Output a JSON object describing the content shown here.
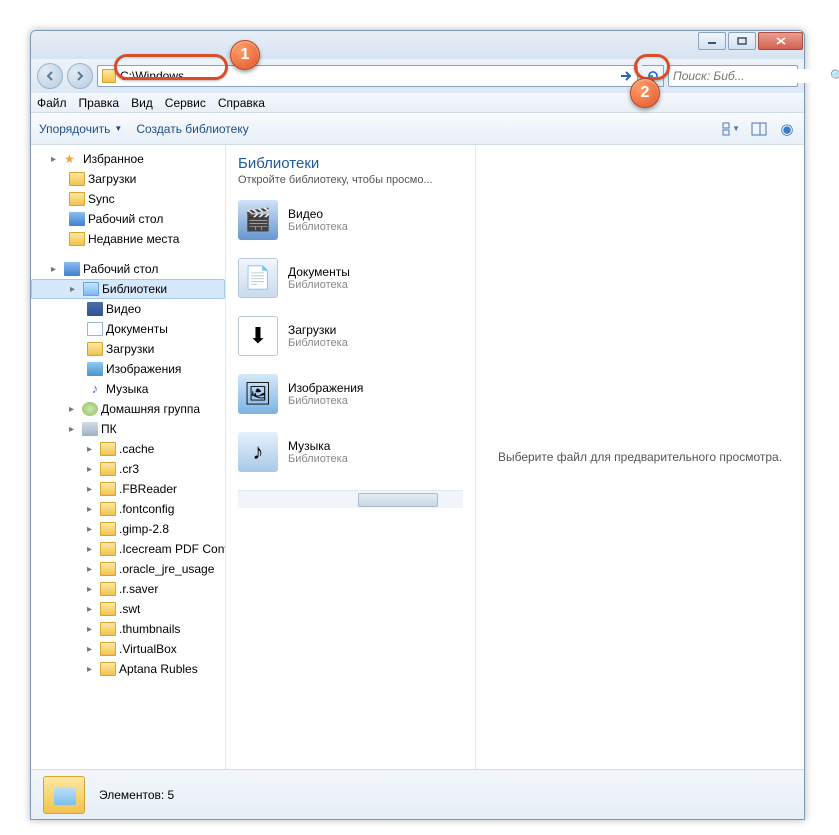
{
  "address_bar": {
    "value": "C:\\Windows"
  },
  "search": {
    "placeholder": "Поиск: Биб..."
  },
  "menu": {
    "file": "Файл",
    "edit": "Правка",
    "view": "Вид",
    "service": "Сервис",
    "help": "Справка"
  },
  "toolbar": {
    "organize": "Упорядочить",
    "create_lib": "Создать библиотеку"
  },
  "sidebar": {
    "fav": "Избранное",
    "downloads": "Загрузки",
    "sync": "Sync",
    "desktop": "Рабочий стол",
    "recent": "Недавние места",
    "desktop2": "Рабочий стол",
    "libraries": "Библиотеки",
    "video": "Видео",
    "documents": "Документы",
    "dl": "Загрузки",
    "images": "Изображения",
    "music": "Музыка",
    "homegroup": "Домашняя группа",
    "pc": "ПК",
    "folders": [
      ".cache",
      ".cr3",
      ".FBReader",
      ".fontconfig",
      ".gimp-2.8",
      ".Icecream PDF Conv",
      ".oracle_jre_usage",
      ".r.saver",
      ".swt",
      ".thumbnails",
      ".VirtualBox",
      "Aptana Rubles"
    ]
  },
  "content": {
    "title": "Библиотеки",
    "subtitle": "Откройте библиотеку, чтобы просмо...",
    "libs": [
      {
        "name": "Видео",
        "type": "Библиотека",
        "icon": "video"
      },
      {
        "name": "Документы",
        "type": "Библиотека",
        "icon": "docs"
      },
      {
        "name": "Загрузки",
        "type": "Библиотека",
        "icon": "dl"
      },
      {
        "name": "Изображения",
        "type": "Библиотека",
        "icon": "img"
      },
      {
        "name": "Музыка",
        "type": "Библиотека",
        "icon": "mus"
      }
    ]
  },
  "preview": {
    "empty": "Выберите файл для предварительного просмотра."
  },
  "status": {
    "label": "Элементов: 5"
  },
  "callouts": {
    "one": "1",
    "two": "2"
  }
}
